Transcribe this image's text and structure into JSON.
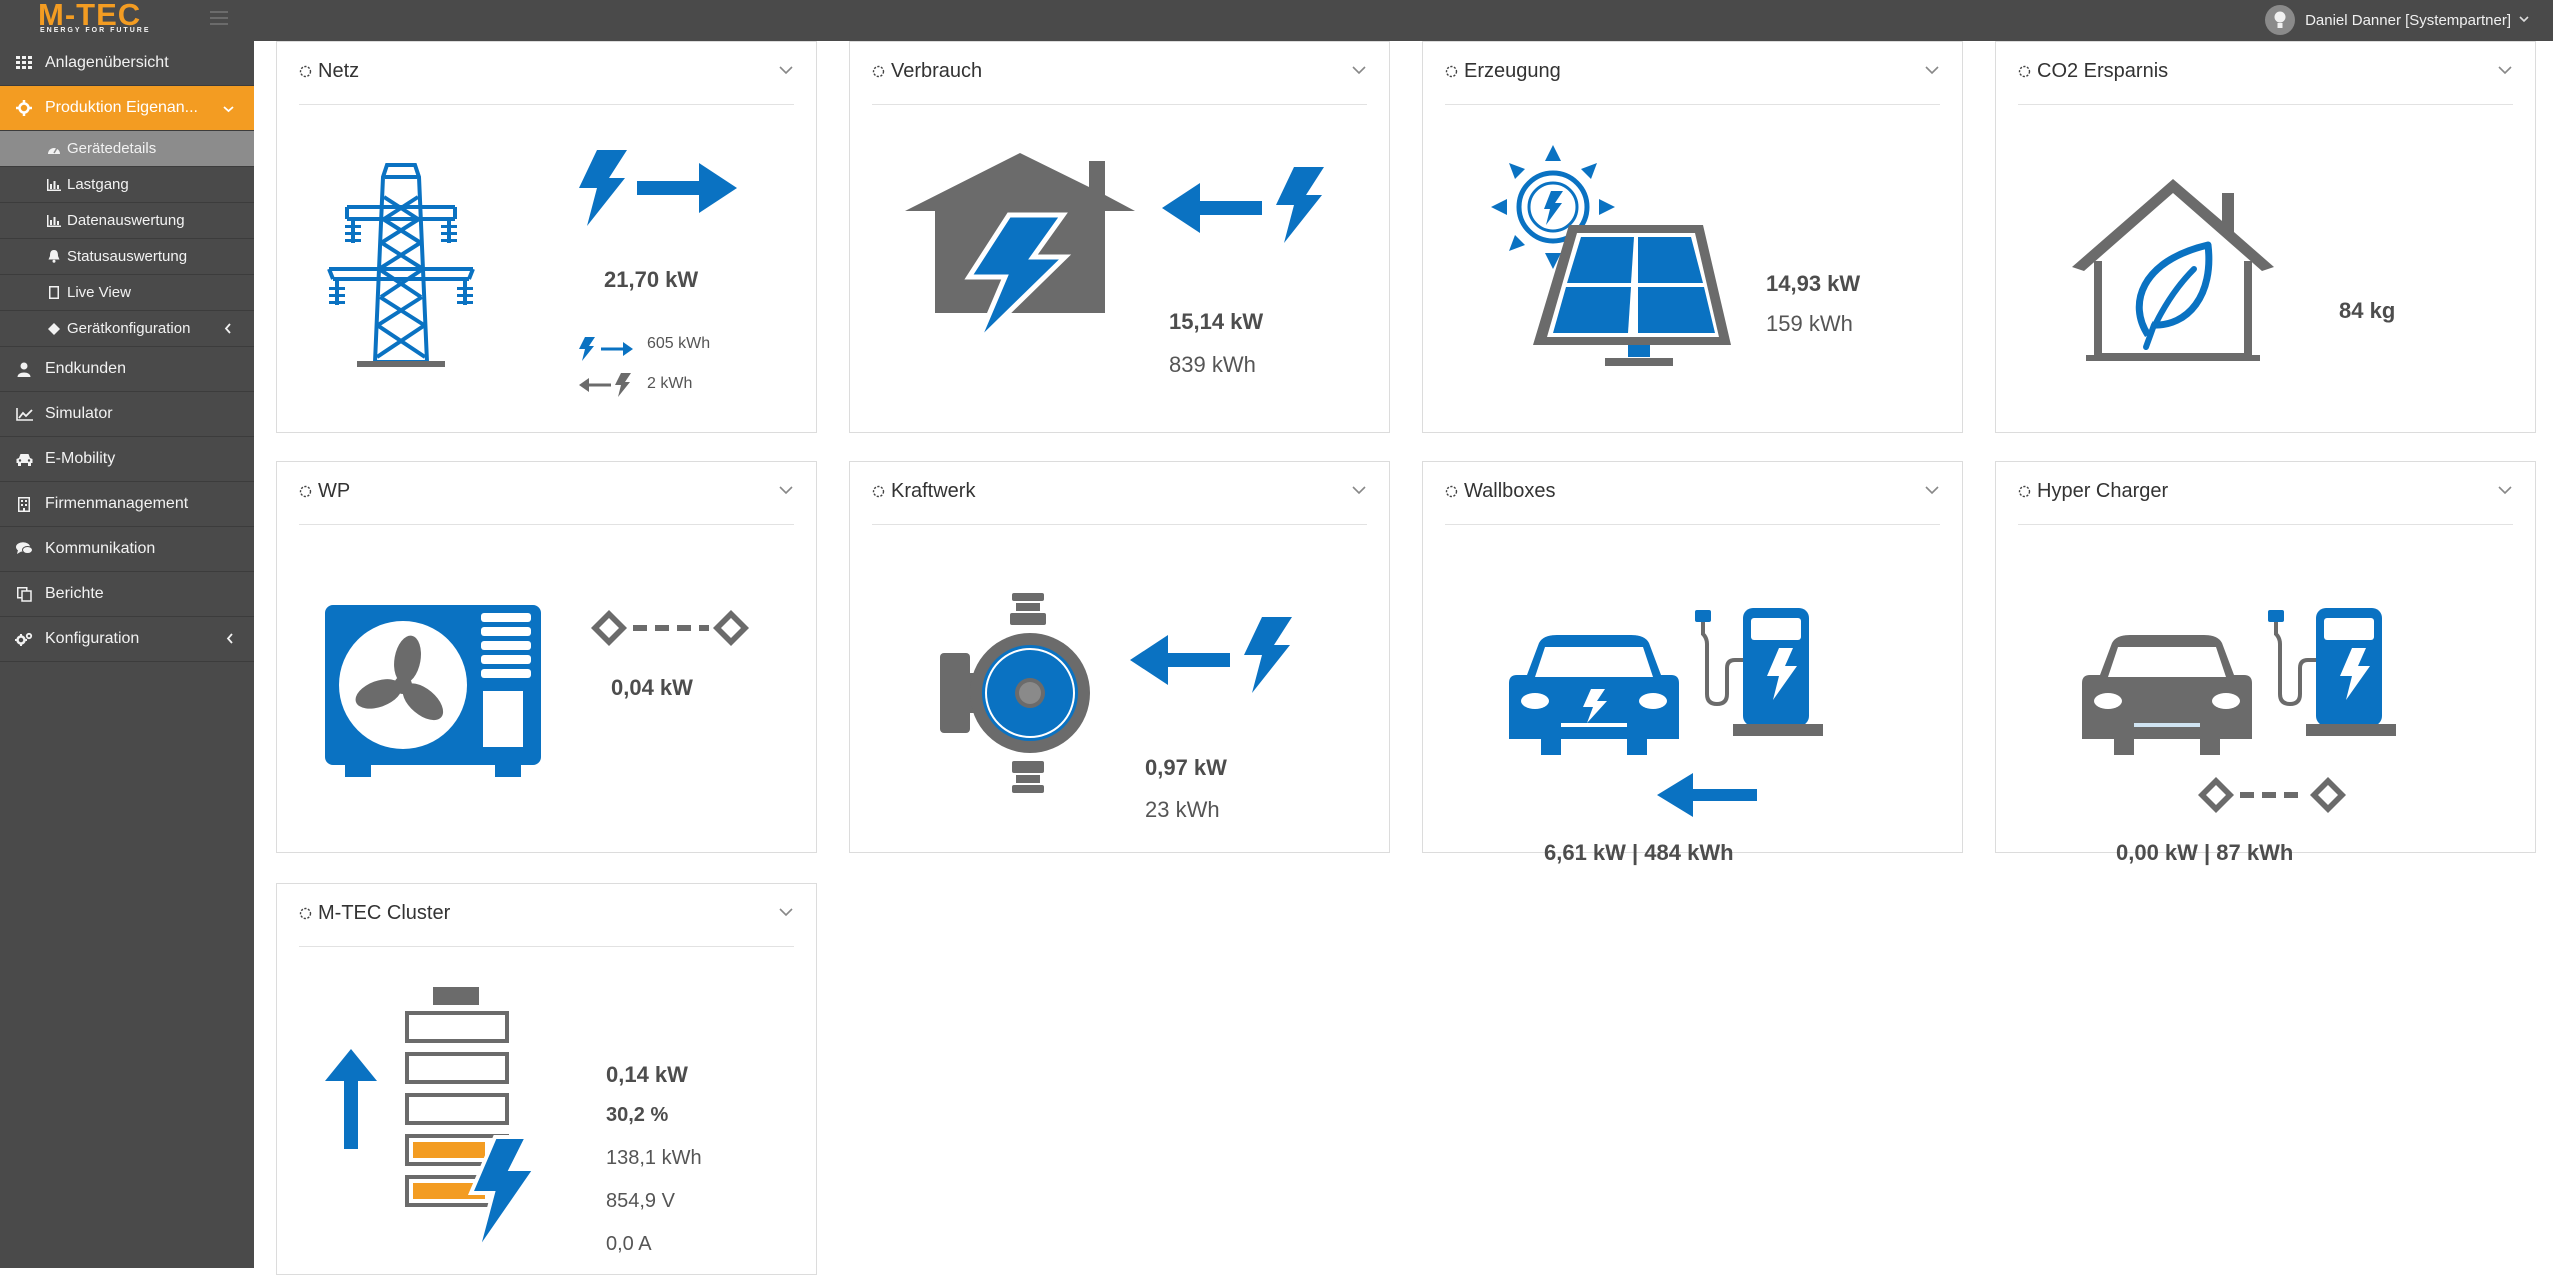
{
  "header": {
    "logo_text": "M-TEC",
    "logo_tagline": "ENERGY FOR FUTURE",
    "user_name": "Daniel Danner [Systempartner]"
  },
  "sidebar": {
    "items": [
      {
        "label": "Anlagenübersicht",
        "icon": "grid-icon"
      },
      {
        "label": "Produktion Eigenan...",
        "icon": "gear-icon"
      },
      {
        "label": "Gerätedetails",
        "icon": "dashboard-icon"
      },
      {
        "label": "Lastgang",
        "icon": "bar-chart-icon"
      },
      {
        "label": "Datenauswertung",
        "icon": "bar-chart-icon"
      },
      {
        "label": "Statusauswertung",
        "icon": "bell-icon"
      },
      {
        "label": "Live View",
        "icon": "file-icon"
      },
      {
        "label": "Gerätkonfiguration",
        "icon": "diamond-icon"
      },
      {
        "label": "Endkunden",
        "icon": "user-icon"
      },
      {
        "label": "Simulator",
        "icon": "line-chart-icon"
      },
      {
        "label": "E-Mobility",
        "icon": "car-icon"
      },
      {
        "label": "Firmenmanagement",
        "icon": "building-icon"
      },
      {
        "label": "Kommunikation",
        "icon": "comments-icon"
      },
      {
        "label": "Berichte",
        "icon": "copy-icon"
      },
      {
        "label": "Konfiguration",
        "icon": "cogs-icon"
      }
    ]
  },
  "cards": {
    "netz": {
      "title": "Netz",
      "power": "21,70 kW",
      "export_energy": "605 kWh",
      "import_energy": "2 kWh"
    },
    "verbrauch": {
      "title": "Verbrauch",
      "power": "15,14 kW",
      "energy": "839 kWh"
    },
    "erzeugung": {
      "title": "Erzeugung",
      "power": "14,93 kW",
      "energy": "159 kWh"
    },
    "co2": {
      "title": "CO2 Ersparnis",
      "value": "84 kg"
    },
    "wp": {
      "title": "WP",
      "power": "0,04 kW"
    },
    "kraftwerk": {
      "title": "Kraftwerk",
      "power": "0,97 kW",
      "energy": "23 kWh"
    },
    "wallboxes": {
      "title": "Wallboxes",
      "summary": "6,61 kW | 484 kWh"
    },
    "hypercharger": {
      "title": "Hyper Charger",
      "summary": "0,00 kW | 87 kWh"
    },
    "cluster": {
      "title": "M-TEC Cluster",
      "power": "0,14 kW",
      "soc": "30,2 %",
      "energy": "138,1 kWh",
      "voltage": "854,9 V",
      "current": "0,0 A",
      "soc_fraction": 0.302
    }
  },
  "colors": {
    "accent": "#f39c22",
    "blue": "#0a72c2",
    "gray": "#6b6b6b",
    "sidebar": "#4a4a4a"
  }
}
